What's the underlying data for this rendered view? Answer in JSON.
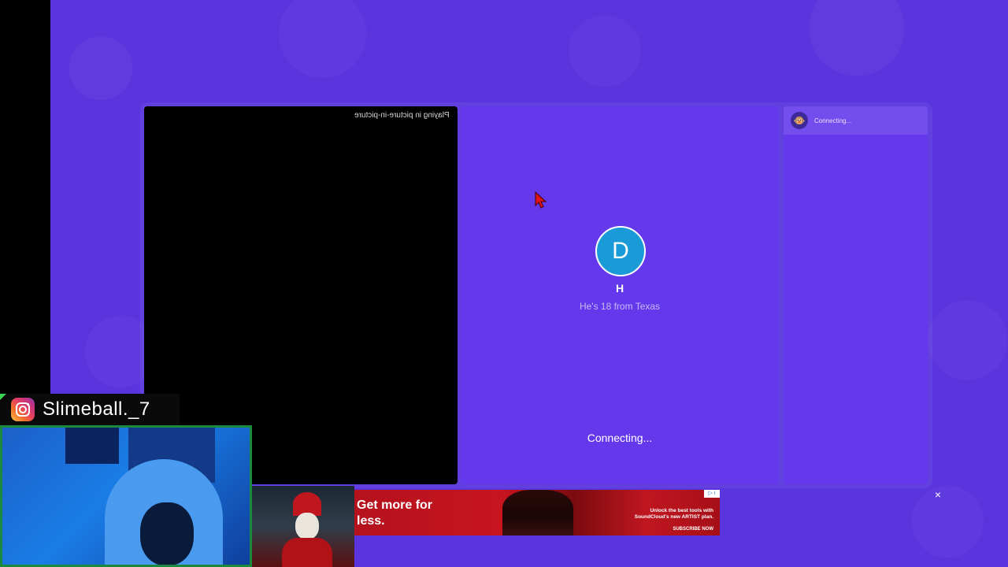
{
  "local_video": {
    "pip_label": "Playing in picture-in-picture"
  },
  "remote": {
    "avatar_initial": "D",
    "name": "H",
    "bio": "He's 18 from Texas",
    "status": "Connecting..."
  },
  "chat": {
    "status": "Connecting...",
    "avatar_icon": "🐵"
  },
  "overlay": {
    "instagram_handle": "Slimeball._7"
  },
  "ad": {
    "headline": "Get more for less.",
    "tagline": "Unlock the best tools with SoundCloud's new ARTIST plan.",
    "cta": "SUBSCRIBE NOW",
    "choices": "▷ i",
    "close": "×"
  },
  "colors": {
    "background": "#5a35de",
    "panel": "#6439ec",
    "avatar": "#1a9ad6",
    "ad_red": "#c8141f"
  }
}
